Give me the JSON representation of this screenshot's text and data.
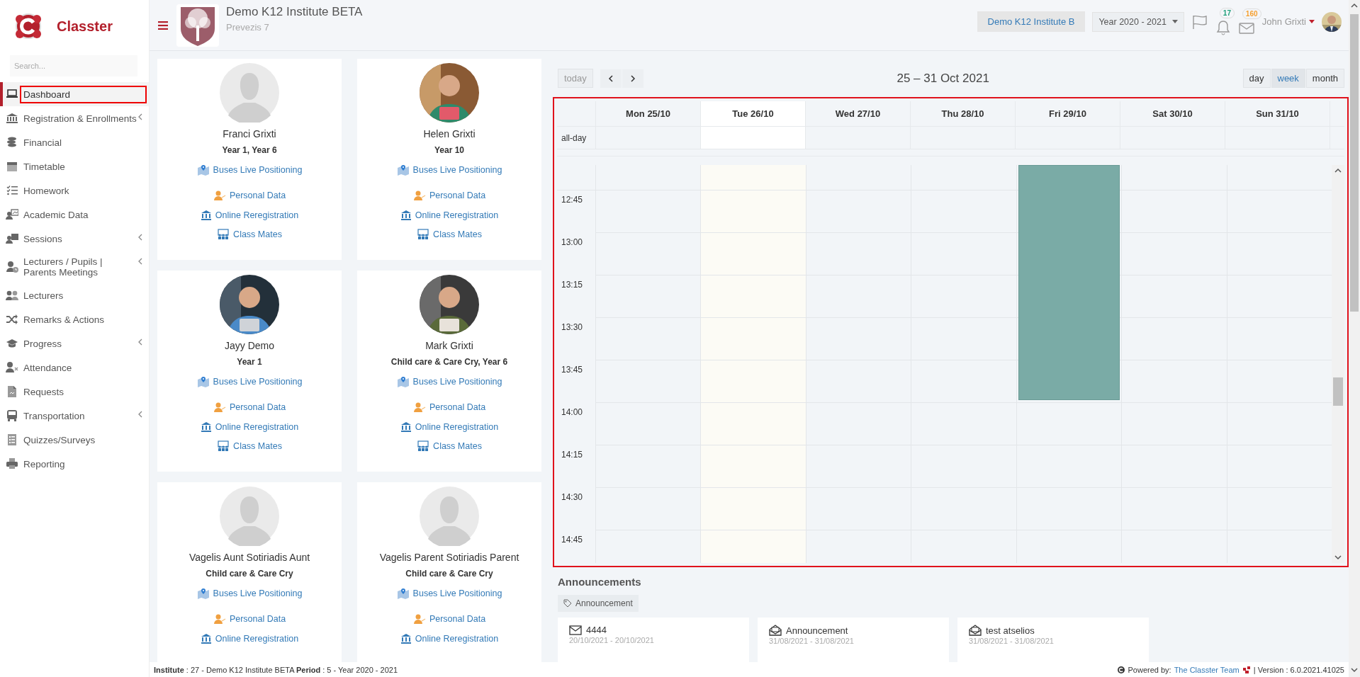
{
  "sidebar": {
    "brand": "Classter",
    "search": {
      "placeholder": "Search..."
    },
    "items": [
      {
        "label": "Dashboard",
        "selected": true,
        "expandable": false,
        "highlighted": true
      },
      {
        "label": "Registration & Enrollments",
        "selected": false,
        "expandable": true,
        "highlighted": false
      },
      {
        "label": "Financial",
        "selected": false,
        "expandable": false,
        "highlighted": false
      },
      {
        "label": "Timetable",
        "selected": false,
        "expandable": false,
        "highlighted": false
      },
      {
        "label": "Homework",
        "selected": false,
        "expandable": false,
        "highlighted": false
      },
      {
        "label": "Academic Data",
        "selected": false,
        "expandable": false,
        "highlighted": false
      },
      {
        "label": "Sessions",
        "selected": false,
        "expandable": true,
        "highlighted": false
      },
      {
        "label": "Lecturers / Pupils | Parents Meetings",
        "selected": false,
        "expandable": true,
        "highlighted": false
      },
      {
        "label": "Lecturers",
        "selected": false,
        "expandable": false,
        "highlighted": false
      },
      {
        "label": "Remarks & Actions",
        "selected": false,
        "expandable": false,
        "highlighted": false
      },
      {
        "label": "Progress",
        "selected": false,
        "expandable": true,
        "highlighted": false
      },
      {
        "label": "Attendance",
        "selected": false,
        "expandable": false,
        "highlighted": false
      },
      {
        "label": "Requests",
        "selected": false,
        "expandable": false,
        "highlighted": false
      },
      {
        "label": "Transportation",
        "selected": false,
        "expandable": true,
        "highlighted": false
      },
      {
        "label": "Quizzes/Surveys",
        "selected": false,
        "expandable": false,
        "highlighted": false
      },
      {
        "label": "Reporting",
        "selected": false,
        "expandable": false,
        "highlighted": false
      }
    ]
  },
  "header": {
    "institute_name": "Demo K12 Institute BETA",
    "institute_address": "Prevezis 7",
    "institute_button": "Demo K12 Institute B",
    "year_select": "Year 2020 - 2021",
    "notifications_count": "17",
    "messages_count": "160",
    "user_name": "John Grixti"
  },
  "students": [
    {
      "name": "Franci Grixti",
      "classes": "Year 1, Year 6",
      "photo": false,
      "links": [
        {
          "kind": "bus",
          "label": "Buses Live Positioning"
        },
        {
          "kind": "person",
          "label": "Personal Data"
        },
        {
          "kind": "bank",
          "label": "Online Reregistration"
        },
        {
          "kind": "class",
          "label": "Class Mates"
        }
      ]
    },
    {
      "name": "Helen Grixti",
      "classes": "Year 10",
      "photo": true,
      "links": [
        {
          "kind": "bus",
          "label": "Buses Live Positioning"
        },
        {
          "kind": "person",
          "label": "Personal Data"
        },
        {
          "kind": "bank",
          "label": "Online Reregistration"
        },
        {
          "kind": "class",
          "label": "Class Mates"
        }
      ]
    },
    {
      "name": "Jayy Demo",
      "classes": "Year 1",
      "photo": true,
      "links": [
        {
          "kind": "bus",
          "label": "Buses Live Positioning"
        },
        {
          "kind": "person",
          "label": "Personal Data"
        },
        {
          "kind": "bank",
          "label": "Online Reregistration"
        },
        {
          "kind": "class",
          "label": "Class Mates"
        }
      ]
    },
    {
      "name": "Mark Grixti",
      "classes": "Child care & Care Cry, Year 6",
      "photo": true,
      "links": [
        {
          "kind": "bus",
          "label": "Buses Live Positioning"
        },
        {
          "kind": "person",
          "label": "Personal Data"
        },
        {
          "kind": "bank",
          "label": "Online Reregistration"
        },
        {
          "kind": "class",
          "label": "Class Mates"
        }
      ]
    },
    {
      "name": "Vagelis Aunt Sotiriadis Aunt",
      "classes": "Child care & Care Cry",
      "photo": false,
      "links": [
        {
          "kind": "bus",
          "label": "Buses Live Positioning"
        },
        {
          "kind": "person",
          "label": "Personal Data"
        },
        {
          "kind": "bank",
          "label": "Online Reregistration"
        }
      ]
    },
    {
      "name": "Vagelis Parent Sotiriadis Parent",
      "classes": "Child care & Care Cry",
      "photo": false,
      "links": [
        {
          "kind": "bus",
          "label": "Buses Live Positioning"
        },
        {
          "kind": "person",
          "label": "Personal Data"
        },
        {
          "kind": "bank",
          "label": "Online Reregistration"
        }
      ]
    }
  ],
  "calendar": {
    "highlighted": true,
    "today_button": "today",
    "title": "25 – 31 Oct 2021",
    "views": [
      {
        "label": "day",
        "selected": false
      },
      {
        "label": "week",
        "selected": true
      },
      {
        "label": "month",
        "selected": false
      }
    ],
    "allday_label": "all-day",
    "days": [
      {
        "label": "Mon 25/10",
        "today": false
      },
      {
        "label": "Tue 26/10",
        "today": true
      },
      {
        "label": "Wed 27/10",
        "today": false
      },
      {
        "label": "Thu 28/10",
        "today": false
      },
      {
        "label": "Fri 29/10",
        "today": false,
        "event": true
      },
      {
        "label": "Sat 30/10",
        "today": false
      },
      {
        "label": "Sun 31/10",
        "today": false
      }
    ],
    "times": [
      "12:45",
      "13:00",
      "13:15",
      "13:30",
      "13:45",
      "14:00",
      "14:15",
      "14:30",
      "14:45"
    ]
  },
  "announcements": {
    "title": "Announcements",
    "tag": "Announcement",
    "items": [
      {
        "kind": "envelope",
        "title": "4444",
        "dates": "20/10/2021 - 20/10/2021"
      },
      {
        "kind": "open-envelope",
        "title": "Announcement",
        "dates": "31/08/2021 - 31/08/2021"
      },
      {
        "kind": "open-envelope",
        "title": "test atselios",
        "dates": "31/08/2021 - 31/08/2021"
      }
    ]
  },
  "footer": {
    "info": "**Institute** : 27 - Demo K12 Institute BETA **Period** : 5 - Year 2020 - 2021",
    "powered_label": "Powered by:",
    "team_link": "The Classter Team",
    "version": "| Version : 6.0.2021.41025"
  }
}
